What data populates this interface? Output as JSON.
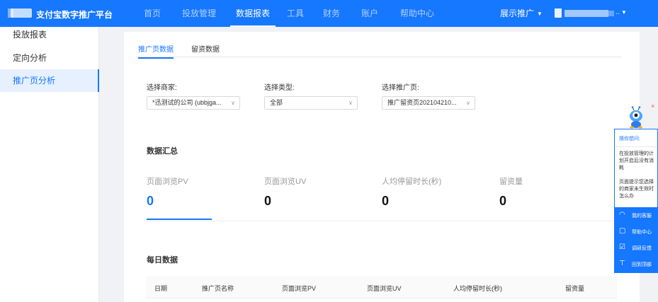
{
  "topbar": {
    "brand": "支付宝数字推广平台",
    "nav": [
      {
        "label": "首页"
      },
      {
        "label": "投放管理"
      },
      {
        "label": "数据报表"
      },
      {
        "label": "工具"
      },
      {
        "label": "财务"
      },
      {
        "label": "账户"
      },
      {
        "label": "帮助中心"
      }
    ],
    "active_nav": "数据报表",
    "promo_label": "展示推广",
    "user_suffix": ".."
  },
  "sidebar": {
    "items": [
      {
        "label": "投放报表"
      },
      {
        "label": "定向分析"
      },
      {
        "label": "推广页分析"
      }
    ],
    "active": "推广页分析"
  },
  "tabs": [
    {
      "label": "推广页数据"
    },
    {
      "label": "留资数据"
    }
  ],
  "filters": {
    "merchant": {
      "label": "选择商家:",
      "value": "*迅测试的公司 (ubbjga..."
    },
    "type": {
      "label": "选择类型:",
      "value": "全部"
    },
    "page": {
      "label": "选择推广页:",
      "value": "推广留资页202104210..."
    }
  },
  "summary": {
    "title": "数据汇总",
    "stats": [
      {
        "label": "页面浏览PV",
        "value": "0"
      },
      {
        "label": "页面浏览UV",
        "value": "0"
      },
      {
        "label": "人均停留时长(秒)",
        "value": "0"
      },
      {
        "label": "留资量",
        "value": "0"
      }
    ]
  },
  "daily": {
    "title": "每日数据",
    "columns": [
      "日期",
      "推广页名称",
      "页面浏览PV",
      "页面浏览UV",
      "人均停留时长(秒)",
      "留资量"
    ]
  },
  "helper": {
    "title": "猜你想问:",
    "questions": [
      "在投放管理的计划开启后没有消耗",
      "页面提示您选择的商家未生效时怎么办"
    ],
    "actions": [
      {
        "label": "我的客服",
        "icon": "headset-icon"
      },
      {
        "label": "帮助中心",
        "icon": "help-icon"
      },
      {
        "label": "调研反馈",
        "icon": "feedback-icon"
      },
      {
        "label": "回到顶部",
        "icon": "to-top-icon"
      }
    ],
    "close": "×"
  },
  "colors": {
    "primary": "#1677ff",
    "close": "#ff4d4f"
  }
}
